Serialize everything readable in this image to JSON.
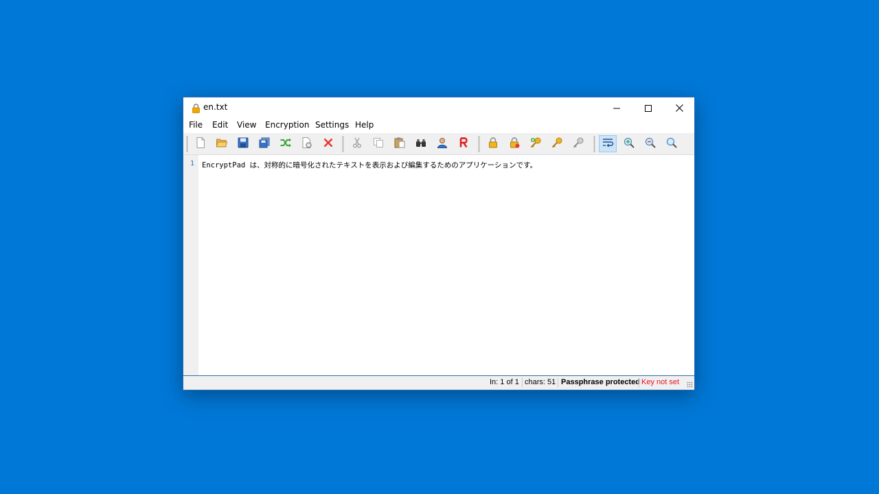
{
  "window": {
    "title": "en.txt",
    "title_icon": "lock-icon",
    "controls": {
      "minimize_icon": "minimize-icon",
      "maximize_icon": "maximize-icon",
      "close_icon": "close-icon"
    }
  },
  "menu": [
    "File",
    "Edit",
    "View",
    "Encryption",
    "Settings",
    "Help"
  ],
  "toolbar": {
    "icons": [
      "new-file-icon",
      "open-folder-icon",
      "save-icon",
      "save-as-icon",
      "shuffle-icon",
      "preferences-icon",
      "close-file-icon",
      "cut-icon",
      "copy-icon",
      "paste-icon",
      "find-binoculars-icon",
      "user-icon",
      "read-only-r-icon",
      "lock-passphrase-icon",
      "lock-key-icon",
      "key-add-icon",
      "key-icon",
      "key-disabled-icon",
      "word-wrap-icon",
      "zoom-in-icon",
      "zoom-out-icon",
      "zoom-reset-icon"
    ],
    "active_icon": "word-wrap-icon"
  },
  "editor": {
    "line_number": "1",
    "text": "EncryptPad は、対称的に暗号化されたテキストを表示および編集するためのアプリケーションです。"
  },
  "status": {
    "position": "In: 1 of 1",
    "chars": "chars: 51",
    "protection": "Passphrase protected",
    "key_status": "Key not set"
  },
  "colors": {
    "desktop": "#0078d7",
    "key_status_red": "#e81123",
    "line_number_blue": "#2b6cb8"
  }
}
